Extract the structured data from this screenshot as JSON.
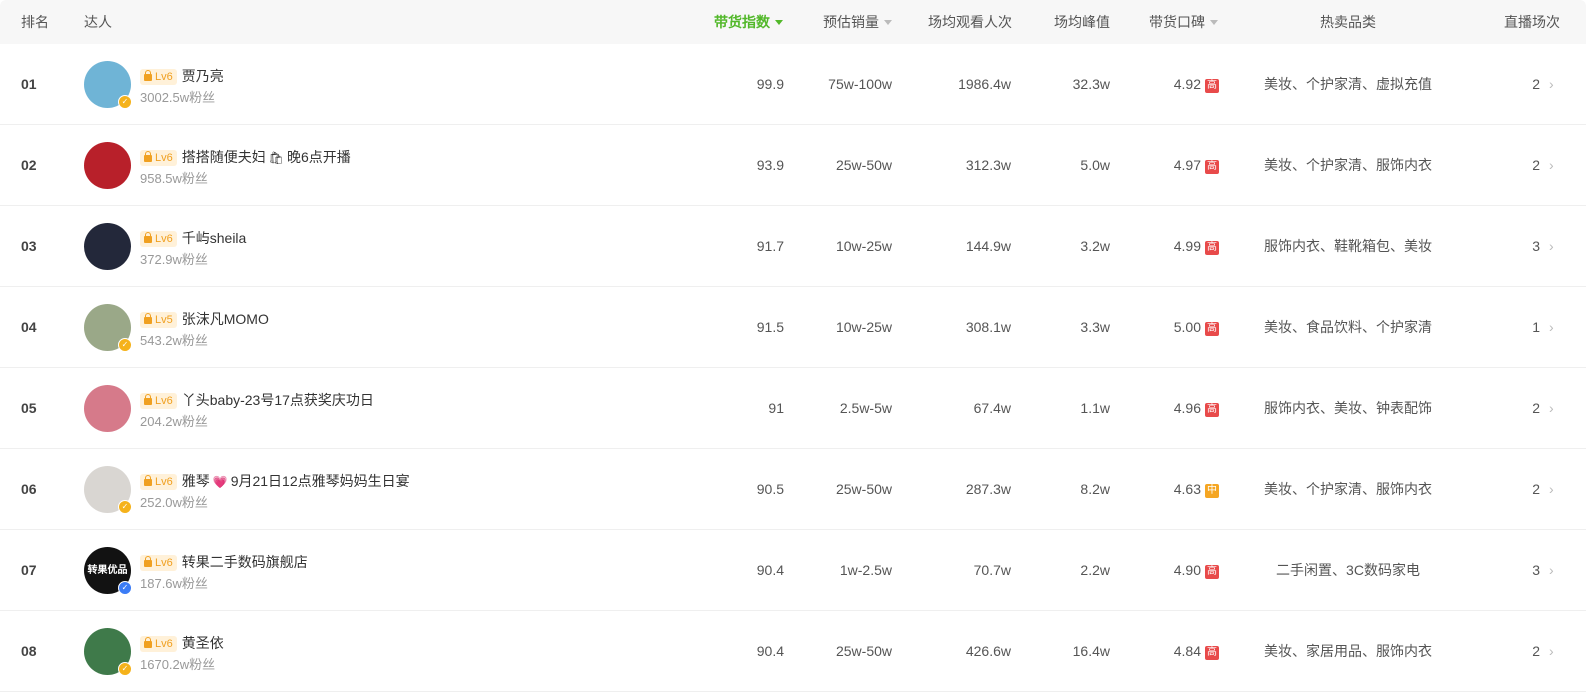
{
  "header": {
    "rank": "排名",
    "creator": "达人",
    "index": "带货指数",
    "sales": "预估销量",
    "viewers": "场均观看人次",
    "peak": "场均峰值",
    "rating": "带货口碑",
    "categories": "热卖品类",
    "sessions": "直播场次"
  },
  "colors": {
    "accent": "#52b82a",
    "badge_high": "#e84a4a",
    "badge_mid": "#f5a623",
    "level": "#f0a020"
  },
  "rows": [
    {
      "rank": "01",
      "level": "Lv6",
      "name": "贾乃亮",
      "emoji": "",
      "name_suffix": "",
      "fans": "3002.5w粉丝",
      "index": "99.9",
      "sales": "75w-100w",
      "viewers": "1986.4w",
      "peak": "32.3w",
      "rating": "4.92",
      "rating_badge": "高",
      "categories": "美妆、个护家清、虚拟充值",
      "sessions": "2",
      "verify": "gold",
      "avatar_color": "#6fb4d6"
    },
    {
      "rank": "02",
      "level": "Lv6",
      "name": "搭搭随便夫妇",
      "emoji": "🛍",
      "name_suffix": "晚6点开播",
      "fans": "958.5w粉丝",
      "index": "93.9",
      "sales": "25w-50w",
      "viewers": "312.3w",
      "peak": "5.0w",
      "rating": "4.97",
      "rating_badge": "高",
      "categories": "美妆、个护家清、服饰内衣",
      "sessions": "2",
      "verify": "",
      "avatar_color": "#b8202a"
    },
    {
      "rank": "03",
      "level": "Lv6",
      "name": "千屿sheila",
      "emoji": "",
      "name_suffix": "",
      "fans": "372.9w粉丝",
      "index": "91.7",
      "sales": "10w-25w",
      "viewers": "144.9w",
      "peak": "3.2w",
      "rating": "4.99",
      "rating_badge": "高",
      "categories": "服饰内衣、鞋靴箱包、美妆",
      "sessions": "3",
      "verify": "",
      "avatar_color": "#23283a"
    },
    {
      "rank": "04",
      "level": "Lv5",
      "name": "张沫凡MOMO",
      "emoji": "",
      "name_suffix": "",
      "fans": "543.2w粉丝",
      "index": "91.5",
      "sales": "10w-25w",
      "viewers": "308.1w",
      "peak": "3.3w",
      "rating": "5.00",
      "rating_badge": "高",
      "categories": "美妆、食品饮料、个护家清",
      "sessions": "1",
      "verify": "gold",
      "avatar_color": "#9aa888"
    },
    {
      "rank": "05",
      "level": "Lv6",
      "name": "丫头baby-23号17点获奖庆功日",
      "emoji": "",
      "name_suffix": "",
      "fans": "204.2w粉丝",
      "index": "91",
      "sales": "2.5w-5w",
      "viewers": "67.4w",
      "peak": "1.1w",
      "rating": "4.96",
      "rating_badge": "高",
      "categories": "服饰内衣、美妆、钟表配饰",
      "sessions": "2",
      "verify": "",
      "avatar_color": "#d67a8a"
    },
    {
      "rank": "06",
      "level": "Lv6",
      "name": "雅琴",
      "emoji": "💗",
      "name_suffix": "9月21日12点雅琴妈妈生日宴",
      "fans": "252.0w粉丝",
      "index": "90.5",
      "sales": "25w-50w",
      "viewers": "287.3w",
      "peak": "8.2w",
      "rating": "4.63",
      "rating_badge": "中",
      "categories": "美妆、个护家清、服饰内衣",
      "sessions": "2",
      "verify": "gold",
      "avatar_color": "#d9d6d2"
    },
    {
      "rank": "07",
      "level": "Lv6",
      "name": "转果二手数码旗舰店",
      "emoji": "",
      "name_suffix": "",
      "fans": "187.6w粉丝",
      "index": "90.4",
      "sales": "1w-2.5w",
      "viewers": "70.7w",
      "peak": "2.2w",
      "rating": "4.90",
      "rating_badge": "高",
      "categories": "二手闲置、3C数码家电",
      "sessions": "3",
      "verify": "blue",
      "avatar_color": "#121212",
      "avatar_text": "转果优品"
    },
    {
      "rank": "08",
      "level": "Lv6",
      "name": "黄圣依",
      "emoji": "",
      "name_suffix": "",
      "fans": "1670.2w粉丝",
      "index": "90.4",
      "sales": "25w-50w",
      "viewers": "426.6w",
      "peak": "16.4w",
      "rating": "4.84",
      "rating_badge": "高",
      "categories": "美妆、家居用品、服饰内衣",
      "sessions": "2",
      "verify": "gold",
      "avatar_color": "#3f7a4a"
    }
  ]
}
